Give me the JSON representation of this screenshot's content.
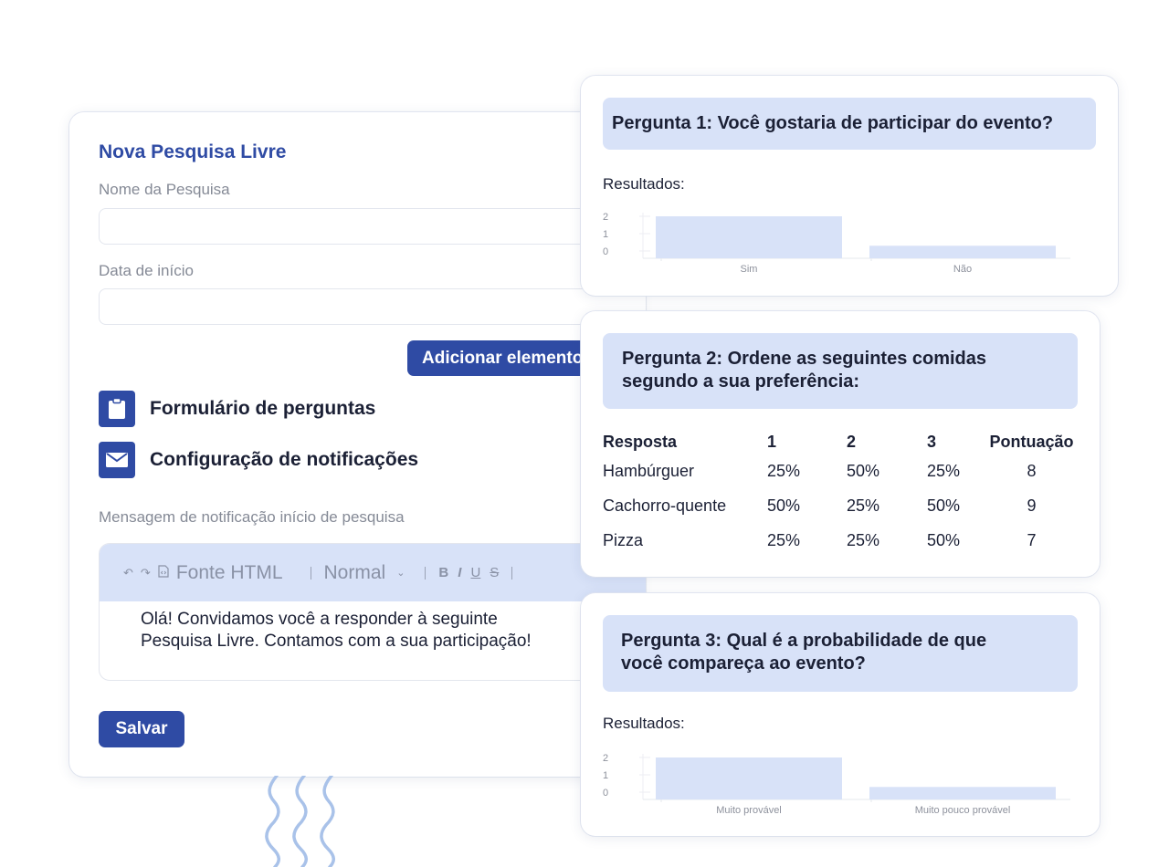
{
  "form": {
    "title": "Nova Pesquisa Livre",
    "name_label": "Nome da Pesquisa",
    "name_value": "",
    "start_date_label": "Data de início",
    "start_date_value": "",
    "add_element_button": "Adicionar elemento",
    "menu_items": [
      {
        "label": "Formulário de perguntas",
        "icon": "clipboard-icon"
      },
      {
        "label": "Configuração de notificações",
        "icon": "envelope-icon"
      }
    ],
    "notification_label": "Mensagem de notificação início de pesquisa",
    "editor": {
      "toolbar": {
        "undo_icon": "↶",
        "redo_icon": "↷",
        "source_label": "Fonte HTML",
        "format_select": "Normal",
        "bold": "B",
        "italic": "I",
        "underline": "U",
        "strike": "S"
      },
      "content_line1": "Olá! Convidamos você a responder à seguinte",
      "content_line2": "Pesquisa Livre. Contamos com a sua participação!"
    },
    "save_button": "Salvar"
  },
  "questions": [
    {
      "title": "Pergunta 1: Você gostaria de participar do evento?",
      "results_label": "Resultados:"
    },
    {
      "title_line1": "Pergunta 2: Ordene as seguintes comidas",
      "title_line2": "segundo a sua preferência:",
      "table": {
        "headers": [
          "Resposta",
          "1",
          "2",
          "3",
          "Pontuação"
        ],
        "rows": [
          [
            "Hambúrguer",
            "25%",
            "50%",
            "25%",
            "8"
          ],
          [
            "Cachorro-quente",
            "50%",
            "25%",
            "50%",
            "9"
          ],
          [
            "Pizza",
            "25%",
            "25%",
            "50%",
            "7"
          ]
        ]
      }
    },
    {
      "title_line1": "Pergunta 3: Qual é a probabilidade de que",
      "title_line2": "você compareça ao evento?",
      "results_label": "Resultados:"
    }
  ],
  "colors": {
    "brand": "#2f4ba4",
    "header_fill": "#d8e2f8",
    "bar_fill": "#d8e2f8",
    "wave": "#a9c2e9"
  },
  "chart_data": [
    {
      "type": "bar",
      "title": "Pergunta 1: Você gostaria de participar do evento?",
      "categories": [
        "Sim",
        "Não"
      ],
      "values": [
        2,
        0.3
      ],
      "y_ticks": [
        "0",
        "1",
        "2"
      ],
      "ylim": [
        0,
        2
      ],
      "xlabel": "",
      "ylabel": "",
      "grid": false
    },
    {
      "type": "bar",
      "title": "Pergunta 3: Qual é a probabilidade de que você compareça ao evento?",
      "categories": [
        "Muito provável",
        "Muito pouco provável"
      ],
      "values": [
        2,
        0.3
      ],
      "y_ticks": [
        "0",
        "1",
        "2"
      ],
      "ylim": [
        0,
        2
      ],
      "xlabel": "",
      "ylabel": "",
      "grid": false
    }
  ]
}
